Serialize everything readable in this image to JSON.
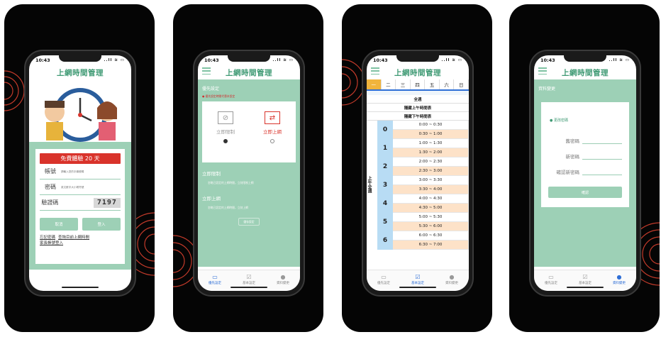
{
  "status": {
    "time": "10:43",
    "icons": "..ll ≋ ▭"
  },
  "app_title": "上網時間管理",
  "nav": [
    {
      "label": "優先設定",
      "icon": "monitor-icon"
    },
    {
      "label": "基本設定",
      "icon": "calendar-check-icon"
    },
    {
      "label": "資料變更",
      "icon": "user-icon"
    }
  ],
  "login": {
    "trial_label": "免費體驗 20 天",
    "account_label": "帳號",
    "account_placeholder": "請輸入您的手機號碼",
    "password_label": "密碼",
    "password_placeholder": "英文數字大小寫符號",
    "captcha_label": "驗證碼",
    "captcha_code": "7197",
    "cancel_label": "取消",
    "login_label": "登入",
    "forgot_label": "忘記密碼",
    "query_label": "查詢目前上網時間",
    "family_label": "家長帳號登入"
  },
  "priority": {
    "section_title": "優先設定",
    "hint": "● 優先設定時間代替本設定",
    "opt_stop_label": "立即限制",
    "opt_online_label": "立即上網",
    "stop_title": "立即限制",
    "stop_desc": "忽略已設定的上網時間，立刻限制上網",
    "online_title": "立即上網",
    "online_desc": "忽略已設定的上網時間，立刻上網",
    "save_label": "儲存設定"
  },
  "schedule": {
    "days": [
      "一",
      "二",
      "三",
      "四",
      "五",
      "六",
      "日"
    ],
    "selected_day": 0,
    "all_week": "全週",
    "hide_am": "隱藏上午時間表",
    "hide_pm": "隱藏下午時間表",
    "side_label": "上午全週",
    "hours": [
      "0",
      "1",
      "2",
      "3",
      "4",
      "5",
      "6"
    ],
    "slots": [
      "0:00 ~ 0:30",
      "0:30 ~ 1:00",
      "1:00 ~ 1:30",
      "1:30 ~ 2:00",
      "2:00 ~ 2:30",
      "2:30 ~ 3:00",
      "3:00 ~ 3:30",
      "3:30 ~ 4:00",
      "4:00 ~ 4:30",
      "4:30 ~ 5:00",
      "5:00 ~ 5:30",
      "5:30 ~ 6:00",
      "6:00 ~ 6:30",
      "6:30 ~ 7:00"
    ]
  },
  "profile": {
    "section_title": "資料變更",
    "change_pw": "● 更改密碼",
    "old_pw": "舊密碼",
    "new_pw": "新密碼",
    "confirm_pw": "確認新密碼",
    "confirm_label": "確認"
  },
  "colors": {
    "green": "#9dd0b6",
    "red": "#d9332b",
    "blue": "#2f6fd6",
    "orange": "#f0b43c"
  }
}
